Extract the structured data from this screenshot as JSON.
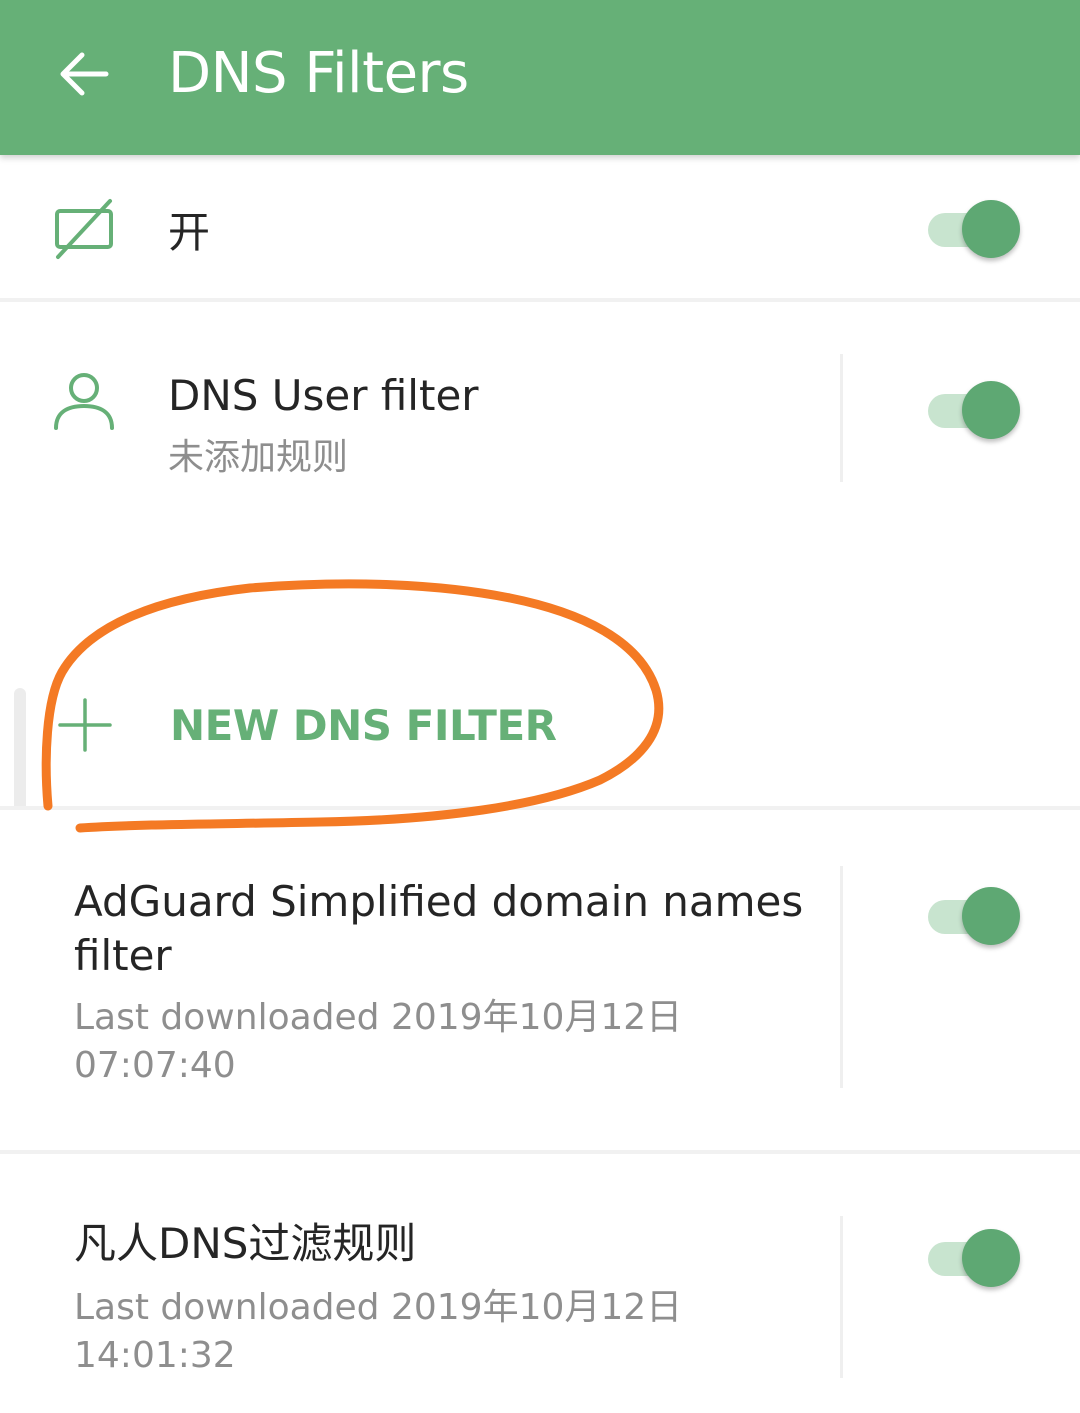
{
  "app_bar": {
    "title": "DNS Filters",
    "back_icon": "arrow-left-icon",
    "background_color": "#66b077"
  },
  "master_switch": {
    "icon": "filter-off-icon",
    "label": "开",
    "enabled": true
  },
  "user_filter": {
    "icon": "person-icon",
    "title": "DNS User filter",
    "subtitle": "未添加规则",
    "enabled": true
  },
  "new_filter": {
    "icon": "plus-icon",
    "label": "NEW DNS FILTER"
  },
  "filters": [
    {
      "title_line1": "AdGuard Simplified domain names",
      "title_line2": "filter",
      "subtitle_line1": "Last downloaded 2019年10月12日",
      "subtitle_line2": "07:07:40",
      "enabled": true
    },
    {
      "title_line1": "凡人DNS过滤规则",
      "subtitle_line1": "Last downloaded 2019年10月12日",
      "subtitle_line2": "14:01:32",
      "enabled": true
    }
  ],
  "colors": {
    "accent": "#66b077",
    "toggle_thumb": "#5ea873",
    "toggle_track": "#c8e4cf",
    "annotation_circle": "#f47a24"
  }
}
